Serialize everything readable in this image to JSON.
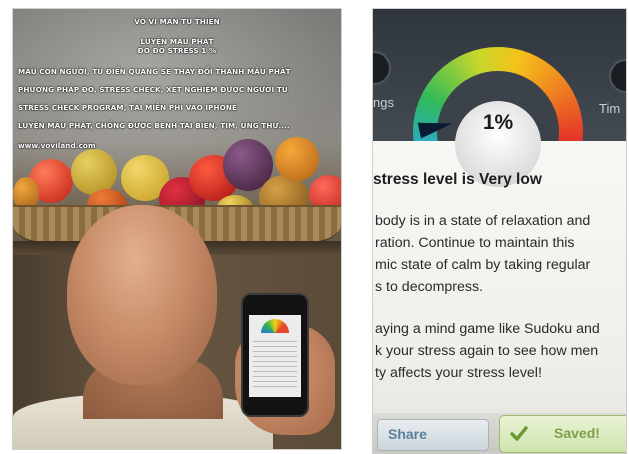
{
  "photo": {
    "overlay": {
      "title": "VÔ VI MAN TU THIỀN",
      "subtitle_1": "LUYỆN MẦU PHẬT",
      "subtitle_2": "ĐO ĐỘ STRESS 1 %",
      "lines": [
        "MÁU CON NGƯỜI, TU ĐIỂN QUANG SẼ THAY ĐỔI THÀNH MẦU PHẬT",
        "PHƯƠNG PHÁP ĐO, STRESS CHECK, XÉT NGHIỆM ĐƯỢC NGƯỜI TU",
        "STRESS CHECK PROGRAM, TẢI MIỄN PHÍ VÀO IPHONE",
        "LUYỆN MẦU PHẬT, CHỐNG ĐƯỢC BỆNH TAI BIẾN, TIM, UNG THƯ....",
        "www.voviland.com"
      ]
    }
  },
  "app": {
    "gauge_percent": "1%",
    "gauge_level": 0.01,
    "left_button_label": "ngs",
    "right_button_label": "Tim",
    "result_title": "stress level is Very low",
    "body_lines": [
      "body is in a state of relaxation and",
      "ration. Continue to maintain this",
      "mic state of calm by taking regular",
      "s to decompress.",
      "",
      "aying a mind game like Sudoku and",
      "k your stress again to see how men",
      "ty affects your stress level!"
    ],
    "share_label": "Share",
    "saved_label": "Saved!",
    "colors": {
      "share_text": "#5a7f9a",
      "saved_text": "#7ea24a"
    }
  }
}
